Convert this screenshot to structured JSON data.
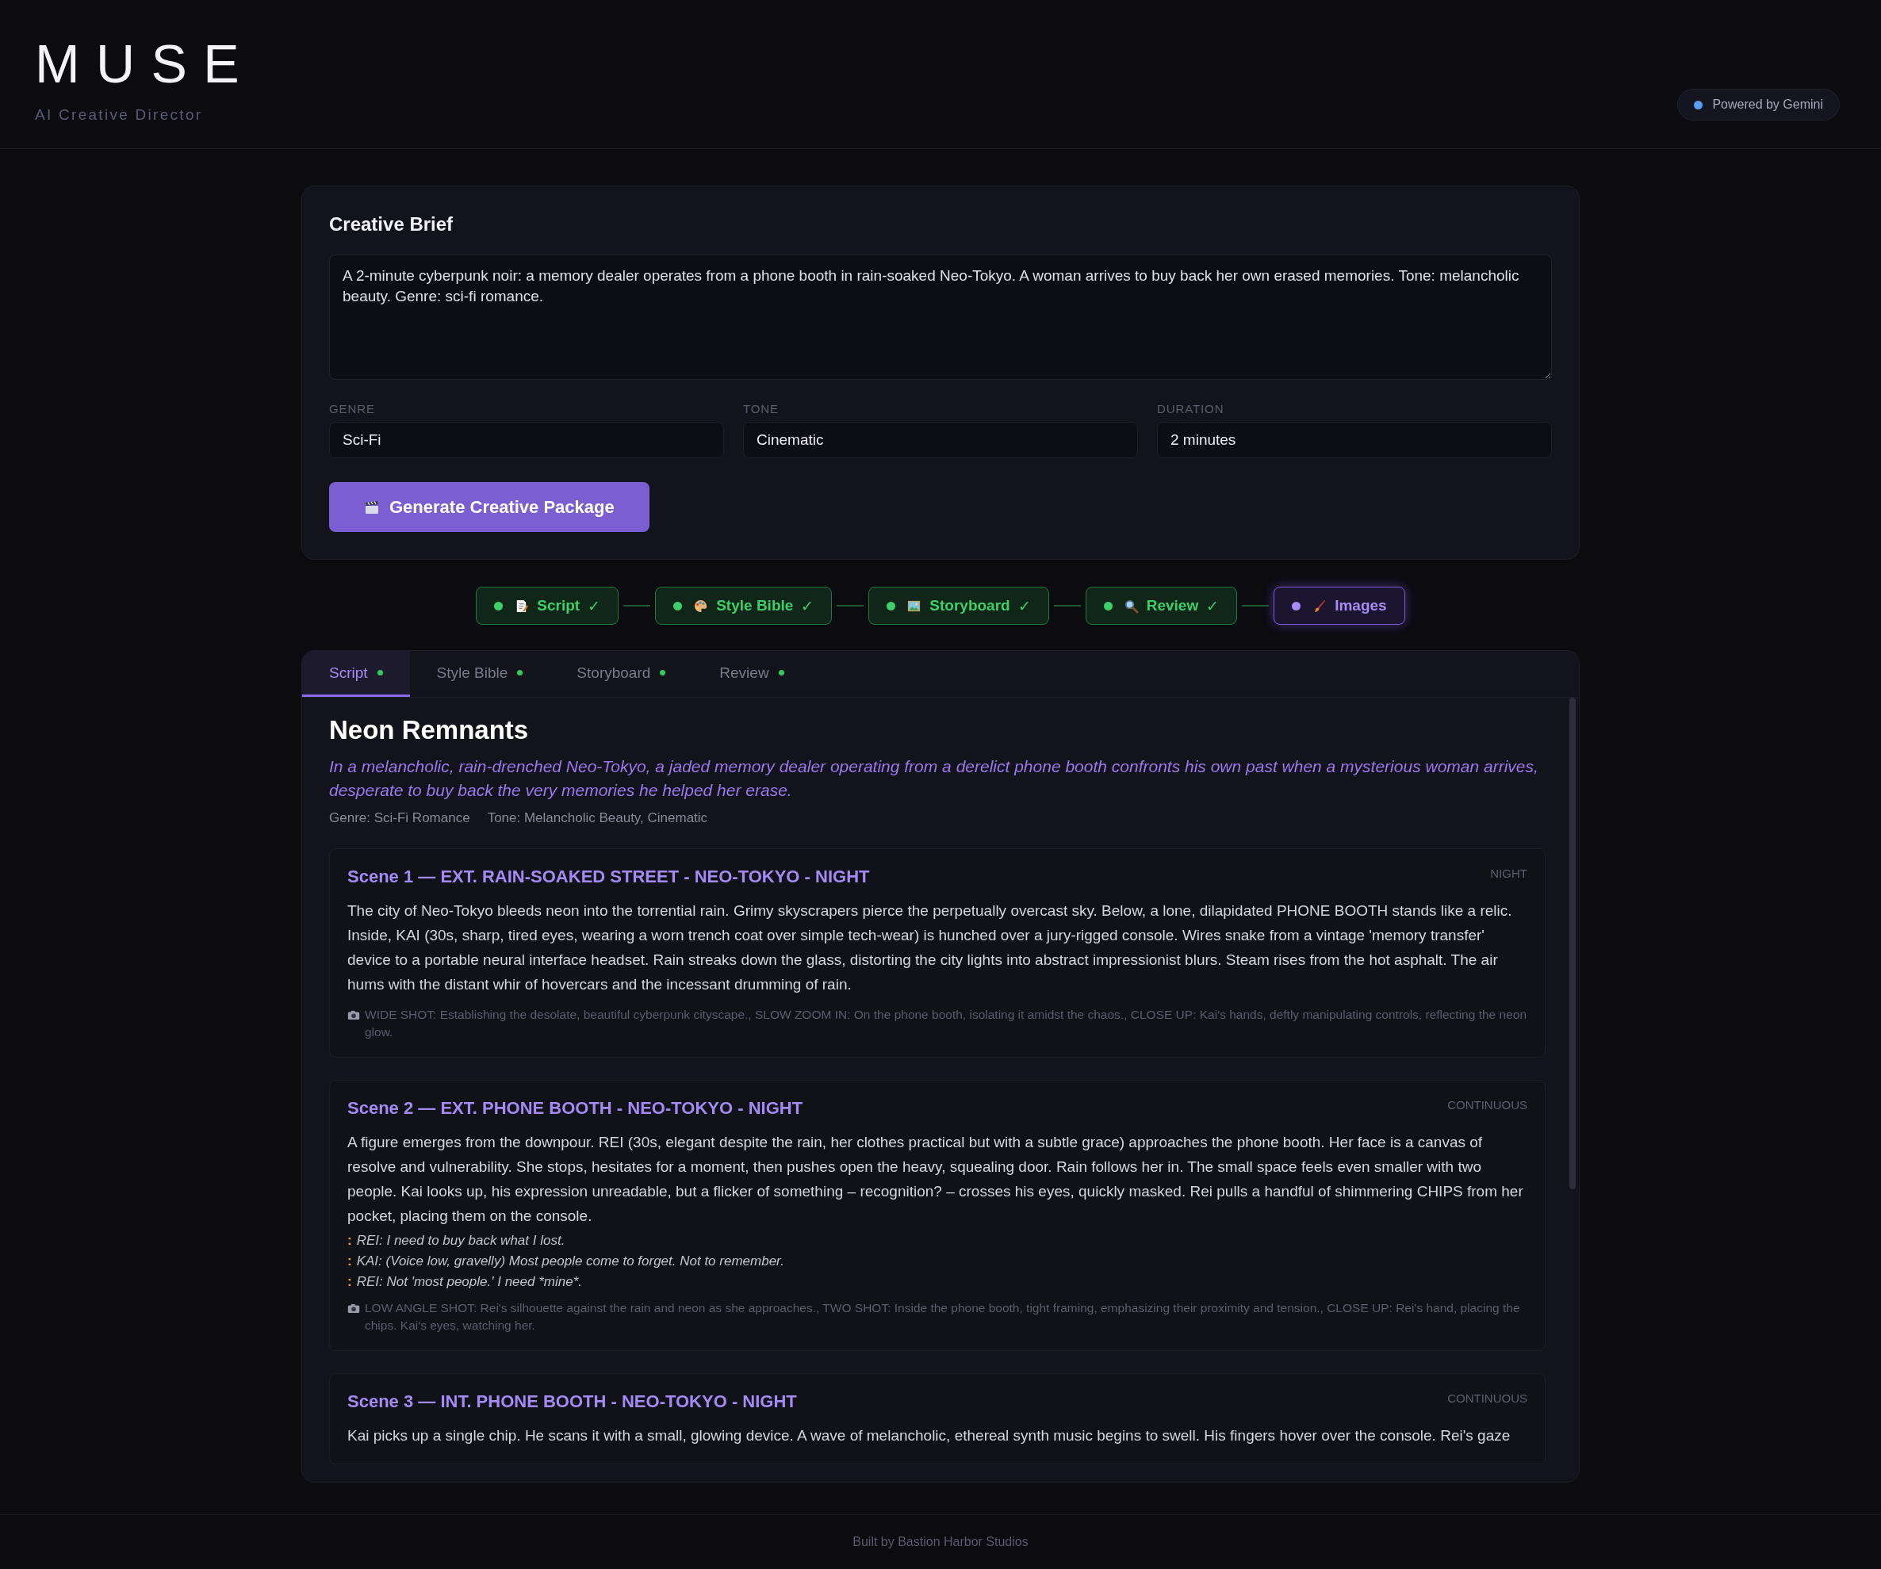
{
  "header": {
    "logo": "MUSE",
    "subtitle": "AI Creative Director",
    "badge": "Powered by Gemini"
  },
  "brief": {
    "title": "Creative Brief",
    "value": "A 2-minute cyberpunk noir: a memory dealer operates from a phone booth in rain-soaked Neo-Tokyo. A woman arrives to buy back her own erased memories. Tone: melancholic beauty. Genre: sci-fi romance.",
    "fields": [
      {
        "label": "GENRE",
        "value": "Sci-Fi"
      },
      {
        "label": "TONE",
        "value": "Cinematic"
      },
      {
        "label": "DURATION",
        "value": "2 minutes"
      }
    ],
    "button": "Generate Creative Package"
  },
  "pipeline": [
    {
      "label": "Script",
      "active": false,
      "mark": "✓"
    },
    {
      "label": "Style Bible",
      "active": false,
      "mark": "✓"
    },
    {
      "label": "Storyboard",
      "active": false,
      "mark": "✓"
    },
    {
      "label": "Review",
      "active": false,
      "mark": "✓"
    },
    {
      "label": "Images",
      "active": true
    }
  ],
  "tabs": [
    {
      "label": "Script",
      "selected": true,
      "done": true
    },
    {
      "label": "Style Bible",
      "selected": false,
      "done": true
    },
    {
      "label": "Storyboard",
      "selected": false,
      "done": true
    },
    {
      "label": "Review",
      "selected": false,
      "done": true
    }
  ],
  "script": {
    "title": "Neon Remnants",
    "logline": "In a melancholic, rain-drenched Neo-Tokyo, a jaded memory dealer operating from a derelict phone booth confronts his own past when a mysterious woman arrives, desperate to buy back the very memories he helped her erase.",
    "meta": [
      "Genre: Sci-Fi Romance",
      "Tone: Melancholic Beauty, Cinematic"
    ],
    "scenes": [
      {
        "heading": "Scene 1 — EXT. RAIN-SOAKED STREET - NEO-TOKYO - NIGHT",
        "time": "NIGHT",
        "action": "The city of Neo-Tokyo bleeds neon into the torrential rain. Grimy skyscrapers pierce the perpetually overcast sky. Below, a lone, dilapidated PHONE BOOTH stands like a relic. Inside, KAI (30s, sharp, tired eyes, wearing a worn trench coat over simple tech-wear) is hunched over a jury-rigged console. Wires snake from a vintage 'memory transfer' device to a portable neural interface headset. Rain streaks down the glass, distorting the city lights into abstract impressionist blurs. Steam rises from the hot asphalt. The air hums with the distant whir of hovercars and the incessant drumming of rain.",
        "shots": "WIDE SHOT: Establishing the desolate, beautiful cyberpunk cityscape., SLOW ZOOM IN: On the phone booth, isolating it amidst the chaos., CLOSE UP: Kai's hands, deftly manipulating controls, reflecting the neon glow."
      },
      {
        "heading": "Scene 2 — EXT. PHONE BOOTH - NEO-TOKYO - NIGHT",
        "time": "CONTINUOUS",
        "action": "A figure emerges from the downpour. REI (30s, elegant despite the rain, her clothes practical but with a subtle grace) approaches the phone booth. Her face is a canvas of resolve and vulnerability. She stops, hesitates for a moment, then pushes open the heavy, squealing door. Rain follows her in. The small space feels even smaller with two people. Kai looks up, his expression unreadable, but a flicker of something – recognition? – crosses his eyes, quickly masked. Rei pulls a handful of shimmering CHIPS from her pocket, placing them on the console.",
        "dialogue": [
          {
            "marker": ":",
            "text": "REI: I need to buy back what I lost."
          },
          {
            "marker": ":",
            "text": "KAI: (Voice low, gravelly) Most people come to forget. Not to remember."
          },
          {
            "marker": ":",
            "text": "REI: Not 'most people.' I need *mine*."
          }
        ],
        "shots": "LOW ANGLE SHOT: Rei's silhouette against the rain and neon as she approaches., TWO SHOT: Inside the phone booth, tight framing, emphasizing their proximity and tension., CLOSE UP: Rei's hand, placing the chips. Kai's eyes, watching her."
      },
      {
        "heading": "Scene 3 — INT. PHONE BOOTH - NEO-TOKYO - NIGHT",
        "time": "CONTINUOUS",
        "action": "Kai picks up a single chip. He scans it with a small, glowing device. A wave of melancholic, ethereal synth music begins to swell. His fingers hover over the console. Rei's gaze"
      }
    ]
  },
  "footer": "Built by Bastion Harbor Studios"
}
